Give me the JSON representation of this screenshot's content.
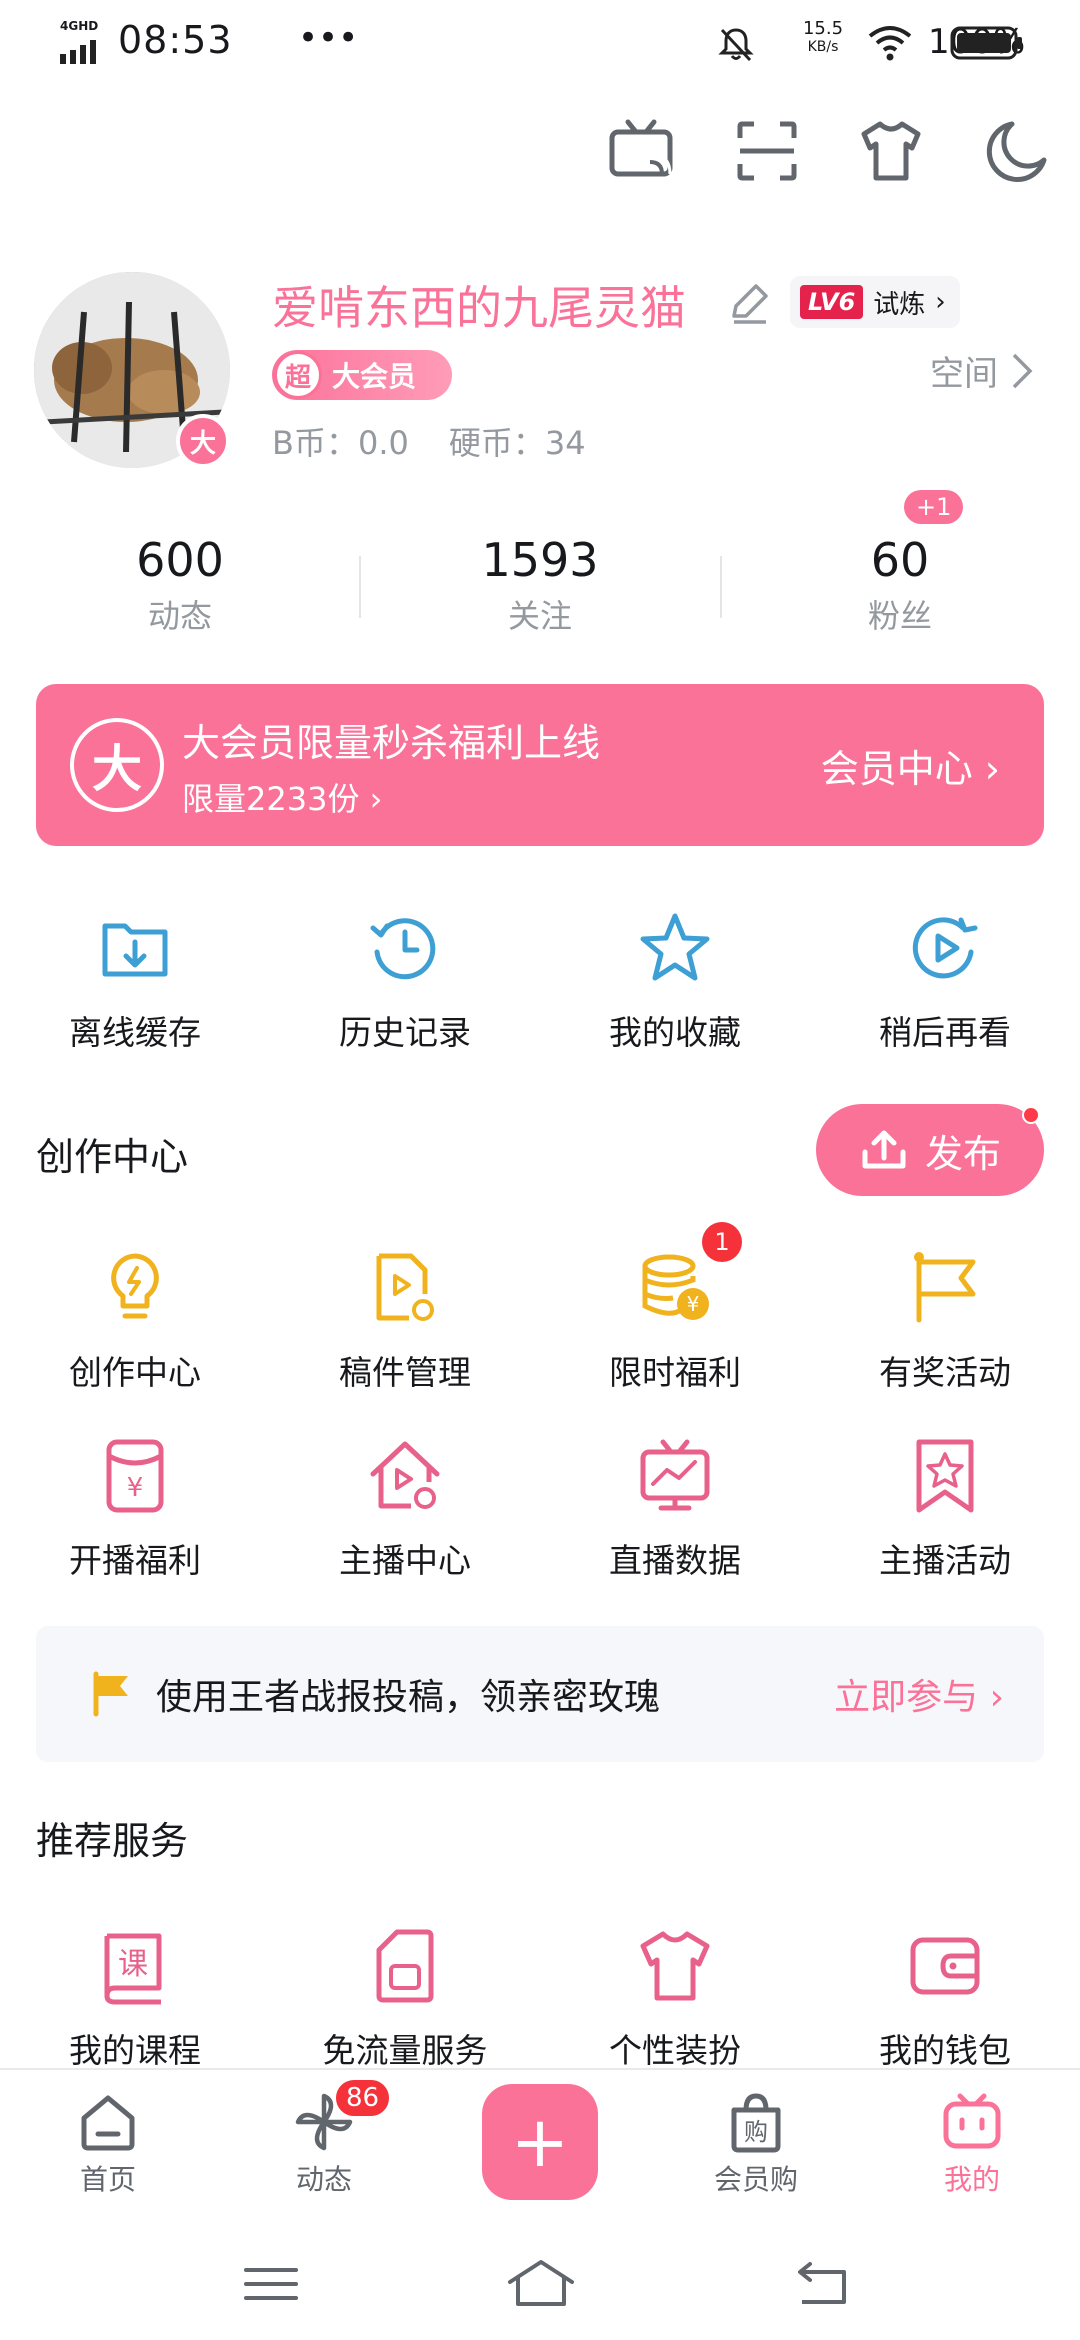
{
  "status_bar": {
    "network": "4GHD",
    "time": "08:53",
    "dots": "•••",
    "speed_value": "15.5",
    "speed_unit": "KB/s",
    "battery": "100%"
  },
  "top_icons": [
    "tv-cast-icon",
    "scan-icon",
    "theme-shirt-icon",
    "night-mode-icon"
  ],
  "profile": {
    "username": "爱啃东西的九尾灵猫",
    "avatar_badge": "大",
    "level": "LV6",
    "level_text": "试炼",
    "vip_super": "超",
    "vip_label": "大会员",
    "space_link": "空间",
    "b_coins": "B币：0.0",
    "coins": "硬币：34"
  },
  "stats": [
    {
      "value": "600",
      "label": "动态"
    },
    {
      "value": "1593",
      "label": "关注"
    },
    {
      "value": "60",
      "label": "粉丝"
    }
  ],
  "fans_badge": "+1",
  "vip_banner": {
    "icon_text": "大",
    "title": "大会员限量秒杀福利上线",
    "subtitle": "限量2233份 ›",
    "cta": "会员中心 ›"
  },
  "quick_access": [
    {
      "label": "离线缓存",
      "icon": "offline-cache-icon"
    },
    {
      "label": "历史记录",
      "icon": "history-icon"
    },
    {
      "label": "我的收藏",
      "icon": "favorites-star-icon"
    },
    {
      "label": "稍后再看",
      "icon": "watch-later-icon"
    }
  ],
  "creation": {
    "title": "创作中心",
    "publish": "发布",
    "badge": "1",
    "items": [
      {
        "label": "创作中心",
        "icon": "bulb-icon"
      },
      {
        "label": "稿件管理",
        "icon": "manuscript-icon"
      },
      {
        "label": "限时福利",
        "icon": "coins-icon"
      },
      {
        "label": "有奖活动",
        "icon": "flag-icon"
      },
      {
        "label": "开播福利",
        "icon": "red-envelope-icon"
      },
      {
        "label": "主播中心",
        "icon": "streamer-home-icon"
      },
      {
        "label": "直播数据",
        "icon": "live-data-icon"
      },
      {
        "label": "主播活动",
        "icon": "streamer-activity-icon"
      }
    ]
  },
  "promo": {
    "text": "使用王者战报投稿，领亲密玫瑰",
    "cta": "立即参与 ›"
  },
  "services": {
    "title": "推荐服务",
    "items": [
      {
        "label": "我的课程",
        "icon": "course-icon",
        "glyph": "课"
      },
      {
        "label": "免流量服务",
        "icon": "sim-card-icon"
      },
      {
        "label": "个性装扮",
        "icon": "tshirt-icon"
      },
      {
        "label": "我的钱包",
        "icon": "wallet-icon"
      }
    ]
  },
  "bottom_nav": {
    "items": [
      {
        "label": "首页",
        "icon": "home-icon"
      },
      {
        "label": "动态",
        "icon": "pinwheel-icon"
      },
      {
        "label": "会员购",
        "icon": "shopping-bag-icon",
        "glyph": "购"
      },
      {
        "label": "我的",
        "icon": "bilibili-tv-icon"
      }
    ],
    "plus": "+",
    "dynamic_badge": "86"
  },
  "colors": {
    "accent": "#fb7299",
    "icon_blue": "#3d9fd4",
    "icon_yellow": "#f0b31d",
    "text_gray": "#9499a0"
  }
}
